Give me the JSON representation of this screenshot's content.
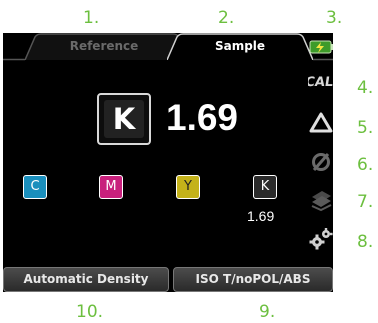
{
  "callouts": {
    "n1": "1.",
    "n2": "2.",
    "n3": "3.",
    "n4": "4.",
    "n5": "5.",
    "n6": "6.",
    "n7": "7.",
    "n8": "8.",
    "n9": "9.",
    "n10": "10."
  },
  "tabs": {
    "reference": "Reference",
    "sample": "Sample",
    "active": "Sample"
  },
  "measurement": {
    "main_channel": "K",
    "main_value": "1.69",
    "k_value": "1.69",
    "channels": [
      "C",
      "M",
      "Y",
      "K"
    ]
  },
  "icons": {
    "cal": "CAL",
    "battery": "battery-charging-icon",
    "delta": "delta-icon",
    "no_filter": "no-filter-icon",
    "layers": "layers-icon",
    "settings": "gear-icon"
  },
  "buttons": {
    "density_mode": "Automatic Density",
    "standard": "ISO T/noPOL/ABS"
  },
  "colors": {
    "callout": "#6cbf3f",
    "cyan": "#1a8fbd",
    "magenta": "#c8207c",
    "yellow": "#c4b21a",
    "black": "#2a2a2a"
  }
}
